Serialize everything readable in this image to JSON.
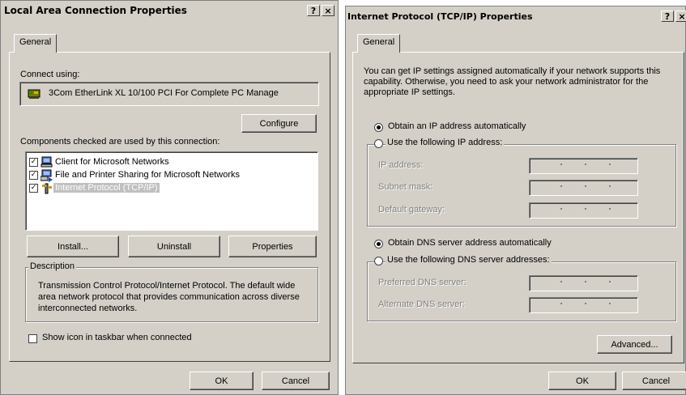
{
  "lac_dialog": {
    "title": "Local Area Connection Properties",
    "help_glyph": "?",
    "close_glyph": "×",
    "tab_general": "General",
    "connect_using_label": "Connect using:",
    "adapter_name": "3Com EtherLink XL 10/100 PCI For Complete PC Manage",
    "configure_label": "Configure",
    "components_label": "Components checked are used by this connection:",
    "components": [
      {
        "label": "Client for Microsoft Networks",
        "checked": true,
        "icon": "network-client-icon"
      },
      {
        "label": "File and Printer Sharing for Microsoft Networks",
        "checked": true,
        "icon": "file-printer-sharing-icon"
      },
      {
        "label": "Internet Protocol (TCP/IP)",
        "checked": true,
        "icon": "protocol-icon",
        "selected": true
      }
    ],
    "install_label": "Install...",
    "uninstall_label": "Uninstall",
    "properties_label": "Properties",
    "description_legend": "Description",
    "description_text": "Transmission Control Protocol/Internet Protocol. The default wide area network protocol that provides communication across diverse interconnected networks.",
    "show_icon_label": "Show icon in taskbar when connected",
    "show_icon_checked": false,
    "ok_label": "OK",
    "cancel_label": "Cancel"
  },
  "tcpip_dialog": {
    "title": "Internet Protocol (TCP/IP) Properties",
    "help_glyph": "?",
    "close_glyph": "×",
    "tab_general": "General",
    "intro_text": "You can get IP settings assigned automatically if your network supports this capability. Otherwise, you need to ask your network administrator for the appropriate IP settings.",
    "obtain_ip_label": "Obtain an IP address automatically",
    "obtain_ip_selected": true,
    "use_following_ip_label": "Use the following IP address:",
    "use_following_ip_selected": false,
    "ip_address_label": "IP address:",
    "subnet_mask_label": "Subnet mask:",
    "default_gateway_label": "Default gateway:",
    "obtain_dns_label": "Obtain DNS server address automatically",
    "obtain_dns_selected": true,
    "use_following_dns_label": "Use the following DNS server addresses:",
    "use_following_dns_selected": false,
    "preferred_dns_label": "Preferred DNS server:",
    "alternate_dns_label": "Alternate DNS server:",
    "advanced_label": "Advanced...",
    "ok_label": "OK",
    "cancel_label": "Cancel"
  },
  "colors": {
    "dialog_face": "#d4d0c8",
    "selection_bg": "#c0c0c0",
    "disabled_text": "#808080"
  }
}
